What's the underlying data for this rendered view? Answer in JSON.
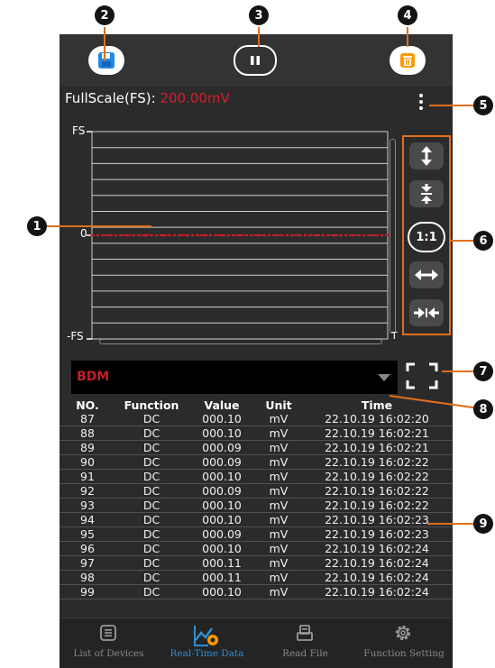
{
  "topbar": {
    "save_icon": "save-icon",
    "pause_icon": "pause-icon",
    "delete_icon": "delete-icon"
  },
  "fullscale": {
    "label": "FullScale(FS):",
    "value": "200.00mV"
  },
  "chart": {
    "y_top_label": "FS",
    "y_zero_label": "0",
    "y_bottom_label": "-FS",
    "x_label": "T",
    "colors": {
      "trace": "#c41e2a",
      "grid": "#cfcfcf"
    }
  },
  "chart_data": {
    "type": "line",
    "title": "",
    "xlabel": "T",
    "ylabel": "",
    "series": [
      {
        "name": "",
        "values": [
          0,
          0,
          0,
          0,
          0,
          0,
          0,
          0,
          0,
          0,
          0,
          0,
          0,
          0,
          0,
          0,
          0,
          0,
          0,
          0,
          0,
          0,
          0,
          0,
          0,
          0,
          0,
          0,
          0,
          0,
          0,
          0,
          0,
          0,
          0,
          0,
          0,
          0,
          0,
          0,
          0,
          0,
          0,
          0,
          0,
          0,
          0,
          0,
          0,
          0,
          0
        ]
      }
    ],
    "y_tick_labels": [
      "FS",
      "0",
      "-FS"
    ],
    "grid": true
  },
  "side_controls": {
    "zoom_in_vertical_icon": "expand-vertical-icon",
    "zoom_out_vertical_icon": "compress-vertical-icon",
    "ratio_label": "1:1",
    "zoom_in_horizontal_icon": "expand-horizontal-icon",
    "zoom_out_horizontal_icon": "compress-horizontal-icon",
    "accent_color": "#e06f1c"
  },
  "mode_dropdown": {
    "value": "BDM"
  },
  "table": {
    "headers": [
      "NO.",
      "Function",
      "Value",
      "Unit",
      "Time"
    ],
    "rows": [
      [
        "87",
        "DC",
        "000.10",
        "mV",
        "22.10.19 16:02:20"
      ],
      [
        "88",
        "DC",
        "000.10",
        "mV",
        "22.10.19 16:02:21"
      ],
      [
        "89",
        "DC",
        "000.09",
        "mV",
        "22.10.19 16:02:21"
      ],
      [
        "90",
        "DC",
        "000.09",
        "mV",
        "22.10.19 16:02:22"
      ],
      [
        "91",
        "DC",
        "000.10",
        "mV",
        "22.10.19 16:02:22"
      ],
      [
        "92",
        "DC",
        "000.09",
        "mV",
        "22.10.19 16:02:22"
      ],
      [
        "93",
        "DC",
        "000.10",
        "mV",
        "22.10.19 16:02:22"
      ],
      [
        "94",
        "DC",
        "000.10",
        "mV",
        "22.10.19 16:02:23"
      ],
      [
        "95",
        "DC",
        "000.09",
        "mV",
        "22.10.19 16:02:23"
      ],
      [
        "96",
        "DC",
        "000.10",
        "mV",
        "22.10.19 16:02:24"
      ],
      [
        "97",
        "DC",
        "000.11",
        "mV",
        "22.10.19 16:02:24"
      ],
      [
        "98",
        "DC",
        "000.11",
        "mV",
        "22.10.19 16:02:24"
      ],
      [
        "99",
        "DC",
        "000.10",
        "mV",
        "22.10.19 16:02:24"
      ]
    ]
  },
  "nav": {
    "items": [
      {
        "label": "List of Devices",
        "icon": "list-icon"
      },
      {
        "label": "Real-Time Data",
        "icon": "realtime-chart-icon"
      },
      {
        "label": "Read File",
        "icon": "read-file-icon"
      },
      {
        "label": "Function Setting",
        "icon": "settings-gear-icon"
      }
    ],
    "active_color": "#2d8fd6"
  },
  "callouts": [
    "1",
    "2",
    "3",
    "4",
    "5",
    "6",
    "7",
    "8",
    "9"
  ]
}
